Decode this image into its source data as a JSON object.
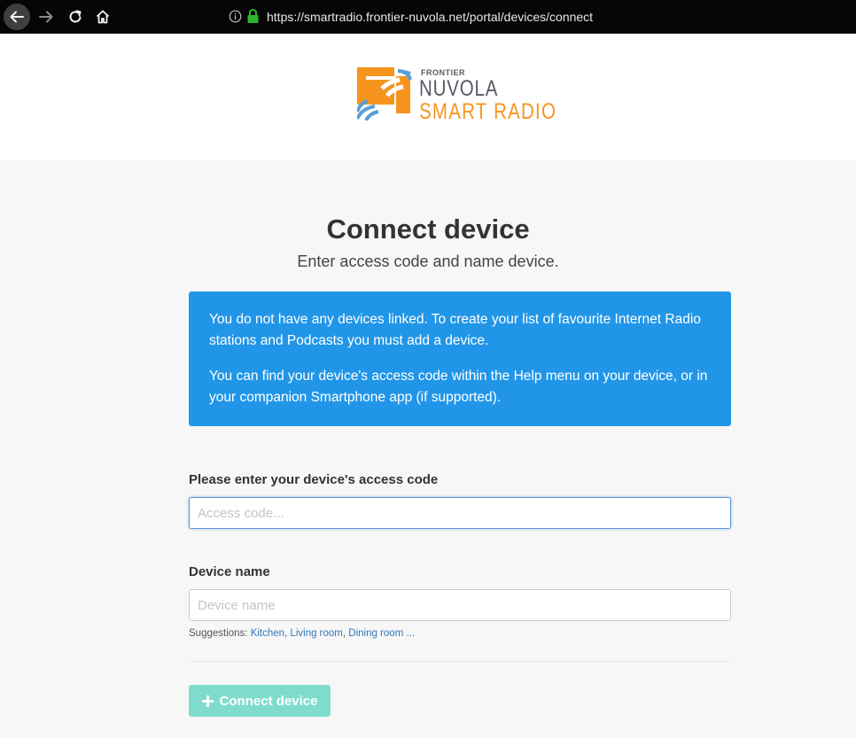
{
  "browser": {
    "url": "https://smartradio.frontier-nuvola.net/portal/devices/connect",
    "icons": [
      "back-arrow-icon",
      "forward-arrow-icon",
      "reload-icon",
      "home-icon",
      "info-icon",
      "lock-icon"
    ]
  },
  "logo": {
    "brand": "FRONTIER",
    "name": "NUVOLA",
    "product": "SMART RADIO",
    "colors": {
      "orange": "#f7941d",
      "blue": "#5a9ed6",
      "grey": "#555b63"
    }
  },
  "main": {
    "title": "Connect device",
    "subtitle": "Enter access code and name device.",
    "alert": {
      "paragraph1": "You do not have any devices linked. To create your list of favourite Internet Radio stations and Podcasts you must add a device.",
      "paragraph2": "You can find your device's access code within the Help menu on your device, or in your companion Smartphone app (if supported).",
      "color": "#2196e8"
    },
    "access_code": {
      "label": "Please enter your device's access code",
      "placeholder": "Access code...",
      "value": ""
    },
    "device_name": {
      "label": "Device name",
      "placeholder": "Device name",
      "value": ""
    },
    "suggestions": {
      "prefix": "Suggestions: ",
      "items": [
        "Kitchen",
        "Living room",
        "Dining room ..."
      ]
    },
    "connect_button": {
      "label": "Connect device",
      "icon": "plus-icon",
      "color": "#7fdccc"
    }
  }
}
